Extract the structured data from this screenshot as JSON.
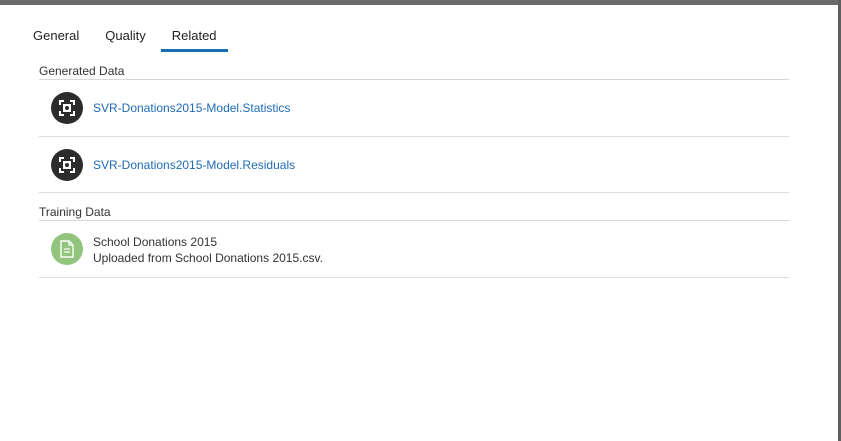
{
  "tabs": [
    {
      "label": "General",
      "active": false
    },
    {
      "label": "Quality",
      "active": false
    },
    {
      "label": "Related",
      "active": true
    }
  ],
  "generated_data": {
    "header": "Generated Data",
    "items": [
      {
        "label": "SVR-Donations2015-Model.Statistics",
        "icon": "model-node-icon"
      },
      {
        "label": "SVR-Donations2015-Model.Residuals",
        "icon": "model-node-icon"
      }
    ]
  },
  "training_data": {
    "header": "Training Data",
    "items": [
      {
        "title": "School Donations 2015",
        "subtitle": "Uploaded from School Donations 2015.csv.",
        "icon": "document-icon"
      }
    ]
  },
  "colors": {
    "accent": "#1a6fb0",
    "link": "#1f6bb5",
    "dark_icon_bg": "#2c2c2c",
    "green_icon_bg": "#93c47d"
  }
}
